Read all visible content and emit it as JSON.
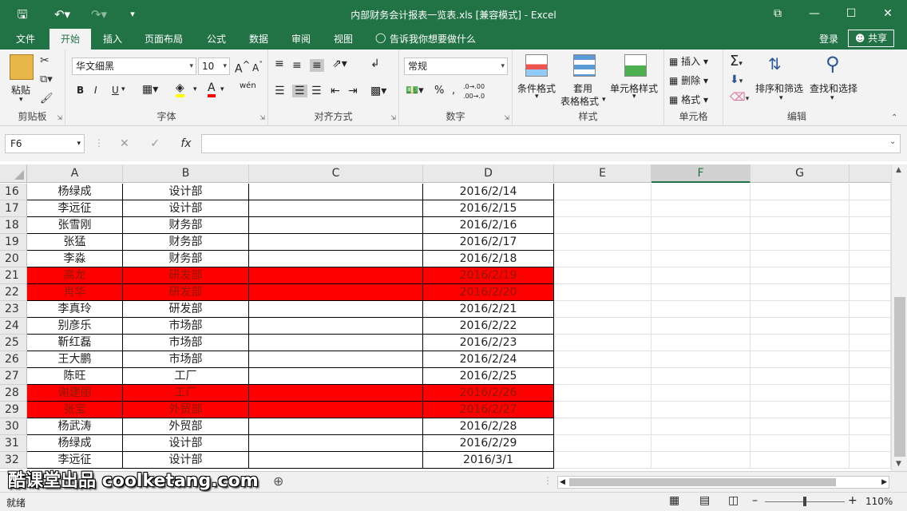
{
  "window": {
    "title": "内部财务会计报表一览表.xls  [兼容模式] - Excel",
    "controls": [
      "⧉",
      "—",
      "☐",
      "✕"
    ]
  },
  "menu": {
    "tabs": [
      "文件",
      "开始",
      "插入",
      "页面布局",
      "公式",
      "数据",
      "审阅",
      "视图"
    ],
    "active": "开始",
    "tellme": "告诉我你想要做什么",
    "login": "登录",
    "share": "共享"
  },
  "ribbon": {
    "clipboard": {
      "label": "剪贴板",
      "paste": "粘贴"
    },
    "font": {
      "label": "字体",
      "name": "华文细黑",
      "size": "10",
      "bold": "B",
      "italic": "I",
      "underline": "U",
      "grow": "A",
      "shrink": "A",
      "fontcolor": "A",
      "phonetic": "wén"
    },
    "alignment": {
      "label": "对齐方式"
    },
    "number": {
      "label": "数字",
      "format": "常规",
      "percent": "%",
      "comma": ",",
      "inc": ".0→.00",
      "dec": ".00→.0"
    },
    "styles": {
      "label": "样式",
      "conditional": "条件格式",
      "table_l1": "套用",
      "table_l2": "表格格式",
      "cell_styles": "单元格样式"
    },
    "cells": {
      "label": "单元格",
      "insert": "插入",
      "delete": "删除",
      "format": "格式"
    },
    "editing": {
      "label": "编辑",
      "sort": "排序和筛选",
      "find": "查找和选择"
    }
  },
  "formula_bar": {
    "name_box": "F6",
    "fx": "fx",
    "formula": ""
  },
  "sheet": {
    "columns": [
      "A",
      "B",
      "C",
      "D",
      "E",
      "F",
      "G"
    ],
    "selected_column": "F",
    "rows": [
      {
        "num": "16",
        "a": "杨绿成",
        "b": "设计部",
        "c": "",
        "d": "2016/2/14",
        "highlight": false
      },
      {
        "num": "17",
        "a": "李远征",
        "b": "设计部",
        "c": "",
        "d": "2016/2/15",
        "highlight": false
      },
      {
        "num": "18",
        "a": "张雪刚",
        "b": "财务部",
        "c": "",
        "d": "2016/2/16",
        "highlight": false
      },
      {
        "num": "19",
        "a": "张猛",
        "b": "财务部",
        "c": "",
        "d": "2016/2/17",
        "highlight": false
      },
      {
        "num": "20",
        "a": "李淼",
        "b": "财务部",
        "c": "",
        "d": "2016/2/18",
        "highlight": false
      },
      {
        "num": "21",
        "a": "高龙",
        "b": "研发部",
        "c": "",
        "d": "2016/2/19",
        "highlight": true
      },
      {
        "num": "22",
        "a": "肖华",
        "b": "研发部",
        "c": "",
        "d": "2016/2/20",
        "highlight": true
      },
      {
        "num": "23",
        "a": "李真玲",
        "b": "研发部",
        "c": "",
        "d": "2016/2/21",
        "highlight": false
      },
      {
        "num": "24",
        "a": "别彦乐",
        "b": "市场部",
        "c": "",
        "d": "2016/2/22",
        "highlight": false
      },
      {
        "num": "25",
        "a": "靳红磊",
        "b": "市场部",
        "c": "",
        "d": "2016/2/23",
        "highlight": false
      },
      {
        "num": "26",
        "a": "王大鹏",
        "b": "市场部",
        "c": "",
        "d": "2016/2/24",
        "highlight": false
      },
      {
        "num": "27",
        "a": "陈旺",
        "b": "工厂",
        "c": "",
        "d": "2016/2/25",
        "highlight": false
      },
      {
        "num": "28",
        "a": "谢建丽",
        "b": "工厂",
        "c": "",
        "d": "2016/2/26",
        "highlight": true
      },
      {
        "num": "29",
        "a": "张宝",
        "b": "外贸部",
        "c": "",
        "d": "2016/2/27",
        "highlight": true
      },
      {
        "num": "30",
        "a": "杨武涛",
        "b": "外贸部",
        "c": "",
        "d": "2016/2/28",
        "highlight": false
      },
      {
        "num": "31",
        "a": "杨绿成",
        "b": "设计部",
        "c": "",
        "d": "2016/2/29",
        "highlight": false
      },
      {
        "num": "32",
        "a": "李远征",
        "b": "设计部",
        "c": "",
        "d": "2016/3/1",
        "highlight": false
      }
    ]
  },
  "status": {
    "ready": "就绪",
    "zoom": "110%"
  },
  "watermark": "酷课堂出品 coolketang.com",
  "colors": {
    "excel_green": "#217346",
    "highlight_red": "#ff0000"
  }
}
